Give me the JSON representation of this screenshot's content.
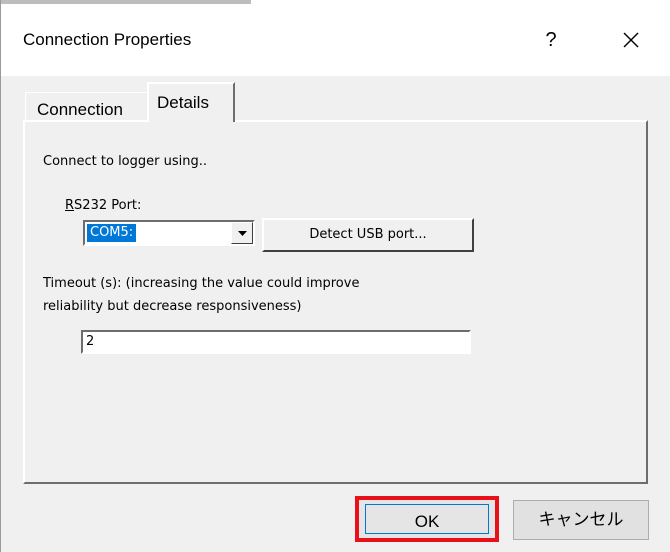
{
  "window": {
    "title": "Connection Properties",
    "help_label": "?"
  },
  "tabs": [
    {
      "label": "Connection",
      "selected": false
    },
    {
      "label": "Details",
      "selected": true
    }
  ],
  "details": {
    "intro_text": "Connect to logger using..",
    "port_label": "RS232 Port:",
    "port_value": "COM5:",
    "detect_button_label": "Detect USB port...",
    "timeout_label_line1": "Timeout (s): (increasing the value could improve",
    "timeout_label_line2": "reliability but decrease responsiveness)",
    "timeout_value": "2"
  },
  "buttons": {
    "ok_label": "OK",
    "cancel_label": "キャンセル"
  },
  "colors": {
    "highlight_box": "#e8111a",
    "selection": "#0078d7"
  }
}
